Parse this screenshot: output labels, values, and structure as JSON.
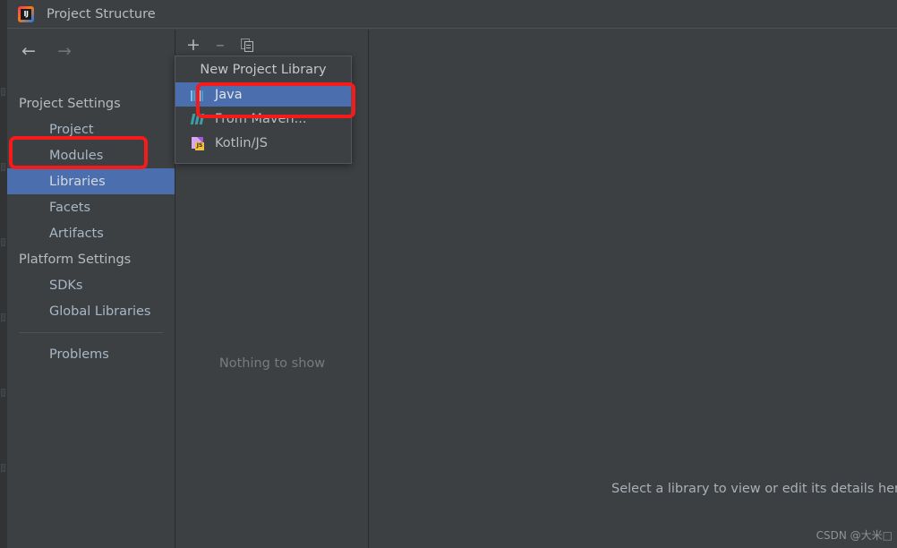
{
  "window": {
    "title": "Project Structure",
    "app_icon": "intellij-idea-icon"
  },
  "navigation": {
    "back_icon": "arrow-left-icon",
    "forward_icon": "arrow-right-icon",
    "tree": [
      {
        "label": "Project Settings",
        "type": "group",
        "selected": false
      },
      {
        "label": "Project",
        "type": "child",
        "selected": false
      },
      {
        "label": "Modules",
        "type": "child",
        "selected": false
      },
      {
        "label": "Libraries",
        "type": "child",
        "selected": true
      },
      {
        "label": "Facets",
        "type": "child",
        "selected": false
      },
      {
        "label": "Artifacts",
        "type": "child",
        "selected": false
      },
      {
        "label": "Platform Settings",
        "type": "group",
        "selected": false
      },
      {
        "label": "SDKs",
        "type": "child",
        "selected": false
      },
      {
        "label": "Global Libraries",
        "type": "child",
        "selected": false
      },
      {
        "label": "Problems",
        "type": "child",
        "selected": false
      }
    ]
  },
  "list_panel": {
    "toolbar": {
      "add_label": "+",
      "add_icon": "plus-icon",
      "remove_label": "–",
      "remove_icon": "minus-icon",
      "copy_icon": "copy-icon"
    },
    "empty_text": "Nothing to show"
  },
  "popup_menu": {
    "header": "New Project Library",
    "items": [
      {
        "label": "Java",
        "icon": "java-icon",
        "selected": true
      },
      {
        "label": "From Maven...",
        "icon": "maven-icon",
        "selected": false
      },
      {
        "label": "Kotlin/JS",
        "icon": "kotlin-js-icon",
        "selected": false
      }
    ]
  },
  "detail_panel": {
    "placeholder": "Select a library to view or edit its details here"
  },
  "watermark": {
    "text": "CSDN @大米□"
  },
  "colors": {
    "background": "#3c4043",
    "selection": "#4b6eaf",
    "annotation": "#f61a19",
    "text_primary": "#a9b7c6",
    "text_muted": "#787b7e"
  }
}
